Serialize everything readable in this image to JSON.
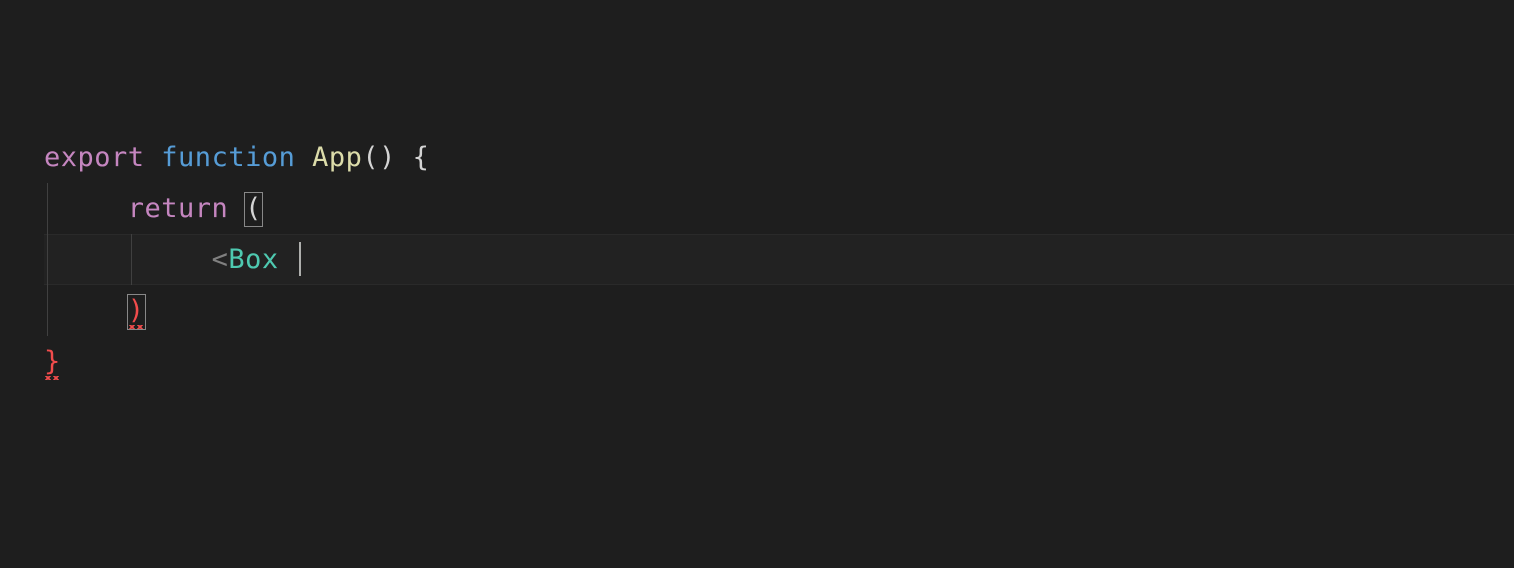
{
  "code": {
    "lines": [
      {
        "tokens": [
          {
            "text": "export ",
            "cls": "tok-keyword"
          },
          {
            "text": "function ",
            "cls": "tok-storage"
          },
          {
            "text": "App",
            "cls": "tok-funcname"
          },
          {
            "text": "() {",
            "cls": "tok-punct"
          }
        ],
        "indent_guides": [],
        "active": false
      },
      {
        "tokens": [
          {
            "text": "return ",
            "cls": "tok-keyword",
            "prefix": "     "
          },
          {
            "text": "(",
            "cls": "tok-punct",
            "bracket_match": true
          }
        ],
        "indent_guides": [
          "guide1"
        ],
        "active": false
      },
      {
        "tokens": [
          {
            "text": "<",
            "cls": "tok-jsx-bracket",
            "prefix": "          "
          },
          {
            "text": "Box ",
            "cls": "tok-jsx-tag"
          }
        ],
        "indent_guides": [
          "guide1",
          "guide2"
        ],
        "cursor_after": true,
        "active": true
      },
      {
        "tokens": [
          {
            "text": ")",
            "cls": "tok-error",
            "prefix": "     ",
            "bracket_match": true,
            "error": true
          }
        ],
        "indent_guides": [
          "guide1"
        ],
        "active": false
      },
      {
        "tokens": [
          {
            "text": "}",
            "cls": "tok-error",
            "error": true
          }
        ],
        "indent_guides": [],
        "active": false
      }
    ]
  },
  "colors": {
    "background": "#1e1e1e",
    "keyword": "#c586c0",
    "storage": "#569cd6",
    "function_name": "#dcdcaa",
    "jsx_tag": "#4ec9b0",
    "jsx_bracket": "#808080",
    "error": "#f14c4c",
    "default": "#d4d4d4",
    "cursor": "#aeafad"
  }
}
